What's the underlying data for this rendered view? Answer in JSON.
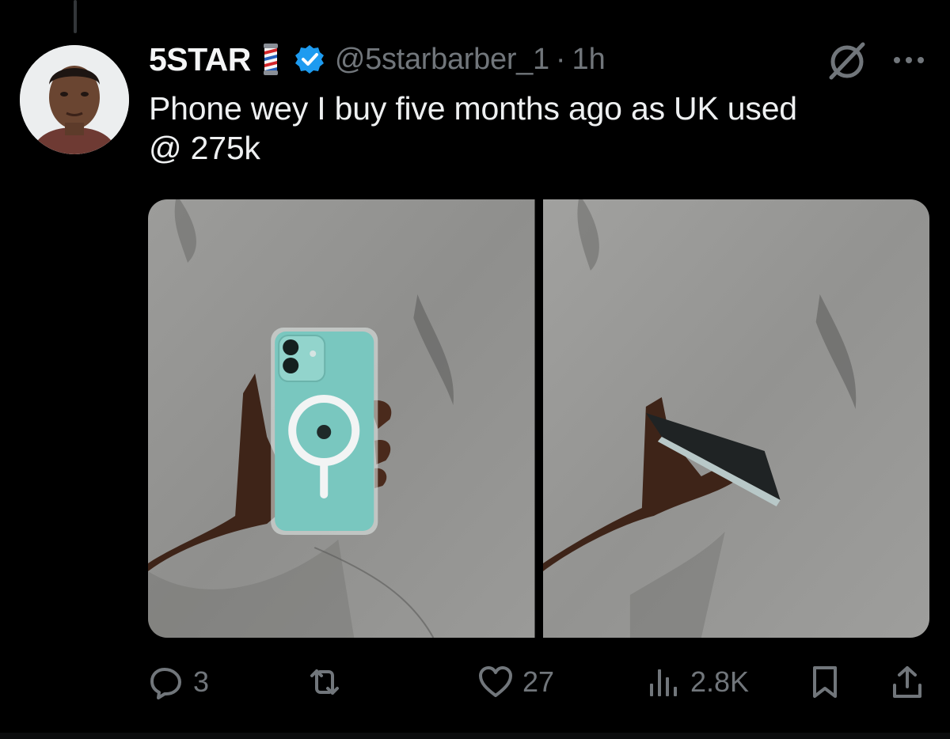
{
  "tweet": {
    "author_name": "5STAR",
    "author_emoji": "barber-pole",
    "verified": true,
    "handle": "@5starbarber_1",
    "separator": "·",
    "time": "1h",
    "text": "Phone wey I buy five months ago as UK used\n@ 275k",
    "media": [
      {
        "description": "hand-holding-phone-front-icon"
      },
      {
        "description": "hand-holding-phone-side-icon"
      }
    ]
  },
  "actions": {
    "replies": "3",
    "reposts": "",
    "likes": "27",
    "views": "2.8K"
  },
  "colors": {
    "background": "#000000",
    "text": "#e7e9ea",
    "muted": "#71767b",
    "verified": "#1d9bf0"
  }
}
